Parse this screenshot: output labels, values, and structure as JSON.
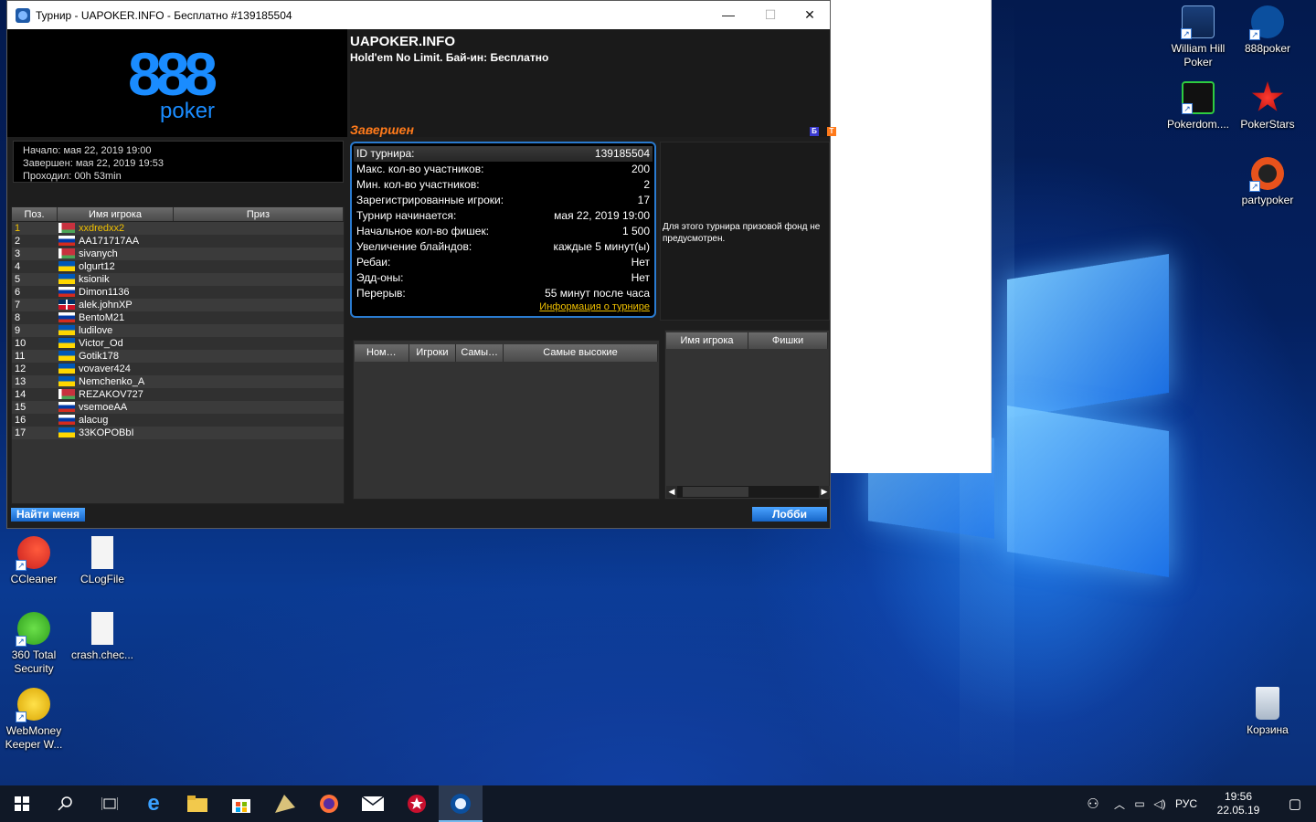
{
  "window": {
    "title": "Турнир - UAPOKER.INFO - Бесплатно #139185504",
    "min": "—",
    "max": "☐",
    "close": "✕"
  },
  "brand": {
    "logo_number": "888",
    "logo_word": "poker"
  },
  "tournament": {
    "name": "UAPOKER.INFO",
    "game": "Hold'em No Limit. Бай-ин: Бесплатно",
    "status": "Завершен",
    "badge_b": "Б",
    "badge_t": "T"
  },
  "dates": {
    "start": "Начало: мая 22, 2019 19:00",
    "end": "Завершен: мая 22, 2019 19:53",
    "duration": "Проходил: 00h 53min"
  },
  "players_table": {
    "headers": [
      "Поз.",
      "Имя игрока",
      "Приз"
    ],
    "rows": [
      {
        "pos": "1",
        "name": "xxdredxx2",
        "flag": "belarus"
      },
      {
        "pos": "2",
        "name": "AA171717AA",
        "flag": "russia"
      },
      {
        "pos": "3",
        "name": "sivanych",
        "flag": "belarus"
      },
      {
        "pos": "4",
        "name": "olgurt12",
        "flag": "ukraine"
      },
      {
        "pos": "5",
        "name": "ksionik",
        "flag": "ukraine"
      },
      {
        "pos": "6",
        "name": "Dimon1136",
        "flag": "russia"
      },
      {
        "pos": "7",
        "name": "alek.johnXP",
        "flag": "dominican"
      },
      {
        "pos": "8",
        "name": "BentoM21",
        "flag": "russia"
      },
      {
        "pos": "9",
        "name": "ludilove",
        "flag": "ukraine"
      },
      {
        "pos": "10",
        "name": "Victor_Od",
        "flag": "ukraine"
      },
      {
        "pos": "11",
        "name": "Gotik178",
        "flag": "ukraine"
      },
      {
        "pos": "12",
        "name": "vovaver424",
        "flag": "ukraine"
      },
      {
        "pos": "13",
        "name": "Nemchenko_A",
        "flag": "ukraine"
      },
      {
        "pos": "14",
        "name": "REZAKOV727",
        "flag": "belarus"
      },
      {
        "pos": "15",
        "name": "vsemoeAA",
        "flag": "russia"
      },
      {
        "pos": "16",
        "name": "alacug",
        "flag": "russia"
      },
      {
        "pos": "17",
        "name": "33KOPOBbI",
        "flag": "ukraine"
      }
    ]
  },
  "details": {
    "rows": [
      {
        "label": "ID турнира:",
        "value": "139185504"
      },
      {
        "label": "Макс. кол-во участников:",
        "value": "200"
      },
      {
        "label": "Мин. кол-во участников:",
        "value": "2"
      },
      {
        "label": "Зарегистрированные игроки:",
        "value": "17"
      },
      {
        "label": "Турнир начинается:",
        "value": "мая 22, 2019 19:00"
      },
      {
        "label": "Начальное кол-во фишек:",
        "value": "1 500"
      },
      {
        "label": "Увеличение блайндов:",
        "value": "каждые 5 минут(ы)"
      },
      {
        "label": "Ребаи:",
        "value": "Нет"
      },
      {
        "label": "Эдд-оны:",
        "value": "Нет"
      },
      {
        "label": "Перерыв:",
        "value": "55 минут после часа"
      }
    ],
    "link": "Информация о турнире"
  },
  "prize_note": "Для этого турнира призовой фонд не предусмотрен.",
  "tables_table": {
    "headers": [
      "Ном…",
      "Игроки",
      "Самы…",
      "Самые высокие"
    ]
  },
  "chips_table": {
    "headers": [
      "Имя игрока",
      "Фишки"
    ]
  },
  "buttons": {
    "find_me": "Найти меня",
    "lobby": "Лобби"
  },
  "desktop_icons": {
    "williamhill": "William Hill Poker",
    "p888": "888poker",
    "pokerdom": "Pokerdom....",
    "pokerstars": "PokerStars",
    "partypoker": "partypoker",
    "ccleaner": "CCleaner",
    "clogfile": "CLogFile",
    "total360": "360 Total Security",
    "crash": "crash.chec...",
    "webmoney": "WebMoney Keeper W...",
    "recycle": "Корзина"
  },
  "taskbar": {
    "lang": "РУС",
    "time": "19:56",
    "date": "22.05.19"
  },
  "colors": {
    "accent_blue": "#1a8cff",
    "status_orange": "#ff7a1a",
    "winner_yellow": "#f0c000"
  }
}
